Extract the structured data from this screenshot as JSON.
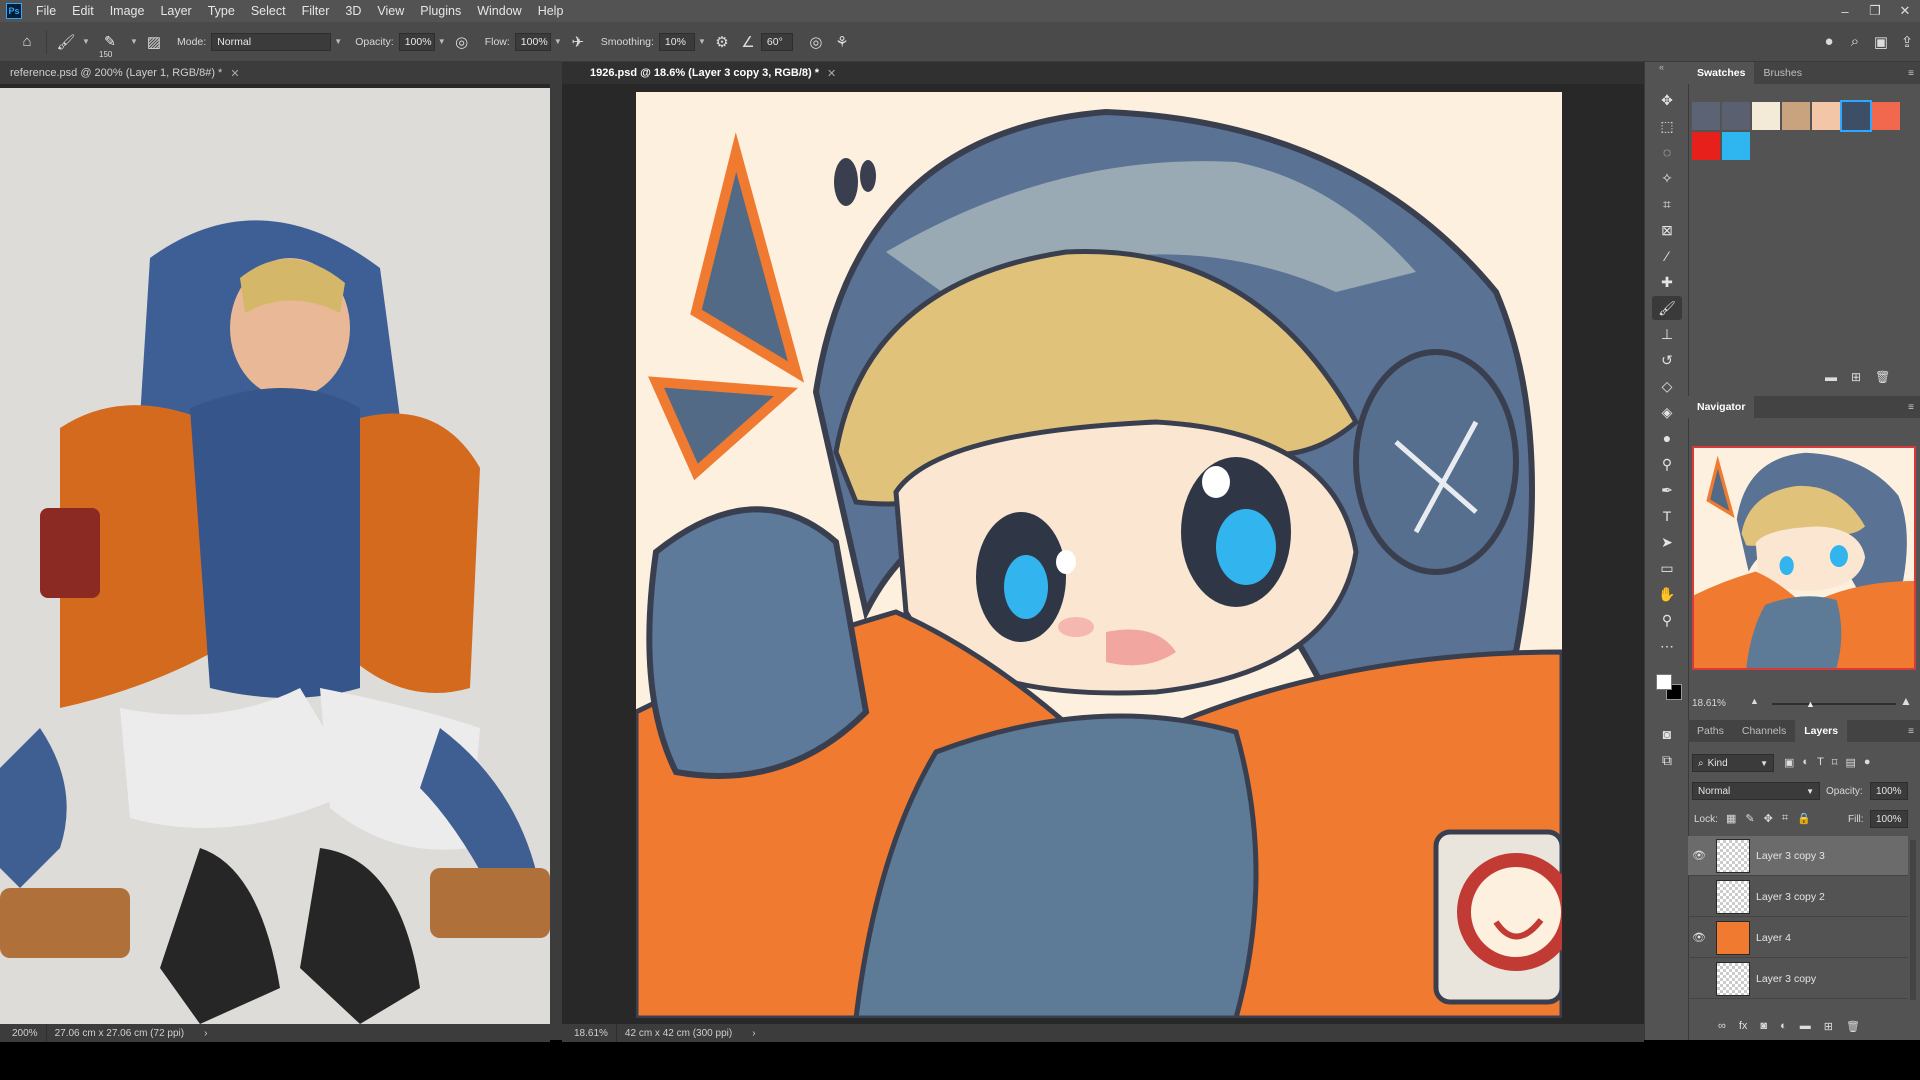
{
  "menu": {
    "logo": "Ps",
    "items": [
      "File",
      "Edit",
      "Image",
      "Layer",
      "Type",
      "Select",
      "Filter",
      "3D",
      "View",
      "Plugins",
      "Window",
      "Help"
    ]
  },
  "options": {
    "brush_size": "150",
    "mode_label": "Mode:",
    "mode_value": "Normal",
    "opacity_label": "Opacity:",
    "opacity_value": "100%",
    "flow_label": "Flow:",
    "flow_value": "100%",
    "smoothing_label": "Smoothing:",
    "smoothing_value": "10%",
    "angle_value": "60°"
  },
  "tabs": {
    "left": "reference.psd @ 200% (Layer 1, RGB/8#) *",
    "right": "1926.psd @ 18.6% (Layer 3 copy 3, RGB/8) *"
  },
  "status": {
    "left_zoom": "200%",
    "left_size": "27.06 cm x 27.06 cm (72 ppi)",
    "right_zoom": "18.61%",
    "right_size": "42 cm x 42 cm (300 ppi)"
  },
  "swatches_panel": {
    "tabs": [
      "Swatches",
      "Brushes"
    ],
    "colors": [
      "#5c6375",
      "#5a6070",
      "#f4ead8",
      "#c9a27e",
      "#f4c6a8",
      "#3d4f66",
      "#f2684e",
      "#e8201c",
      "#2fb5f0"
    ]
  },
  "navigator": {
    "title": "Navigator",
    "zoom": "18.61%"
  },
  "layers_panel": {
    "tabs": [
      "Paths",
      "Channels",
      "Layers"
    ],
    "kind_label": "Kind",
    "blend_mode": "Normal",
    "opacity_label": "Opacity:",
    "opacity_value": "100%",
    "lock_label": "Lock:",
    "fill_label": "Fill:",
    "fill_value": "100%",
    "layers": [
      {
        "name": "Layer 3 copy 3",
        "visible": true
      },
      {
        "name": "Layer 3 copy 2",
        "visible": false
      },
      {
        "name": "Layer 4",
        "visible": true
      },
      {
        "name": "Layer 3 copy",
        "visible": false
      }
    ]
  }
}
